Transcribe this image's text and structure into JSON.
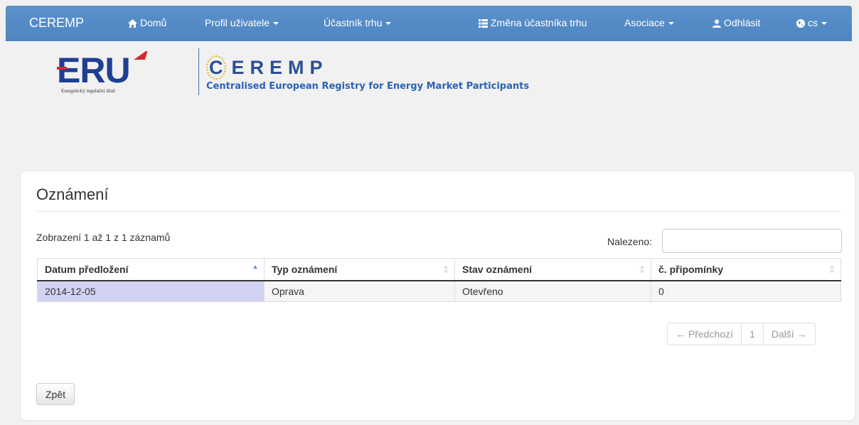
{
  "navbar": {
    "brand": "CEREMP",
    "home": "Domů",
    "profile": "Profil uživatele",
    "participant": "Účastník trhu",
    "change_participant": "Změna účastníka trhu",
    "association": "Asociace",
    "logout": "Odhlásit",
    "language": "cs"
  },
  "header": {
    "eru_logo_text": "ERÚ",
    "eru_subtitle": "Energetický regulační úřad",
    "ceremp_title": "EREMP",
    "ceremp_c": "C",
    "ceremp_subtitle": "Centralised European Registry for Energy Market Participants"
  },
  "panel": {
    "title": "Oznámení",
    "info": "Zobrazení 1 až 1 z 1 záznamů",
    "search_label": "Nalezeno:",
    "search_value": "",
    "columns": [
      "Datum předložení",
      "Typ oznámení",
      "Stav oznámení",
      "č. připomínky"
    ],
    "rows": [
      [
        "2014-12-05",
        "Oprava",
        "Otevřeno",
        "0"
      ]
    ],
    "pager": {
      "prev": "← Předchozí",
      "page": "1",
      "next": "Další →"
    },
    "back_button": "Zpět"
  },
  "colors": {
    "navbar": "#5b91cb",
    "sorted_cell": "#d2d3f3",
    "logo_blue": "#2a4f96"
  }
}
